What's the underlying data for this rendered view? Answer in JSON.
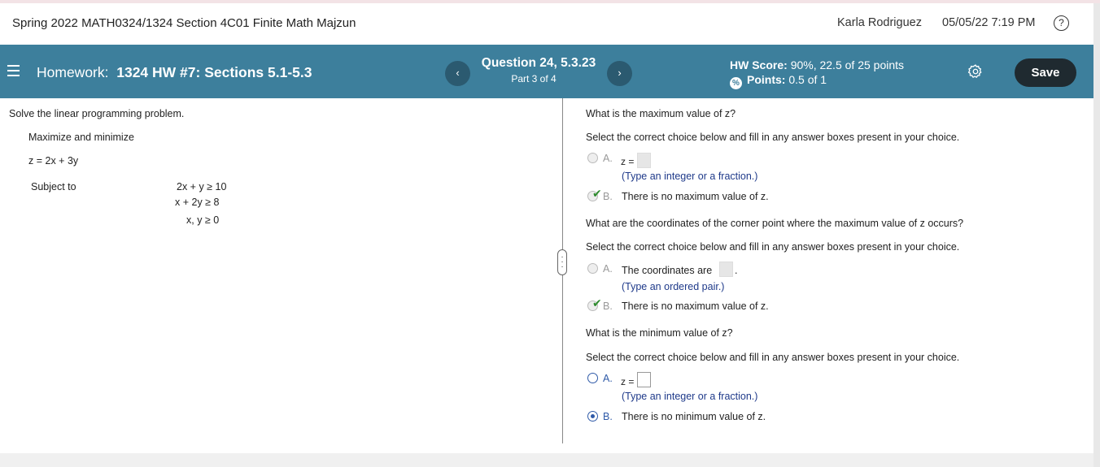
{
  "header": {
    "course_title": "Spring 2022 MATH0324/1324 Section 4C01 Finite Math Majzun",
    "user_name": "Karla Rodriguez",
    "datetime": "05/05/22 7:19 PM",
    "help_glyph": "?"
  },
  "hwbar": {
    "homework_prefix": "Homework:",
    "homework_name": "1324 HW #7: Sections 5.1-5.3",
    "prev_glyph": "‹",
    "next_glyph": "›",
    "question_title": "Question 24, 5.3.23",
    "question_part": "Part 3 of 4",
    "score_label": "HW Score:",
    "score_value": "90%, 22.5 of 25 points",
    "points_label": "Points:",
    "points_value": "0.5 of 1",
    "save_label": "Save",
    "colors": {
      "bar": "#3d7f9c",
      "save_button": "#1f2a30"
    }
  },
  "problem": {
    "instruction": "Solve the linear programming problem.",
    "task": "Maximize and minimize",
    "objective": "z = 2x + 3y",
    "subject_to": "Subject to",
    "constraints": [
      "2x + y  ≥  10",
      "x + 2y  ≥  8",
      "x, y  ≥  0"
    ]
  },
  "questions": [
    {
      "prompt": "What is the maximum value of z?",
      "instruction": "Select the correct choice below and fill in any answer boxes present in your choice.",
      "options": [
        {
          "letter": "A.",
          "text": "z =",
          "hint": "(Type an integer or a fraction.)"
        },
        {
          "letter": "B.",
          "text": "There is no maximum value of z."
        }
      ]
    },
    {
      "prompt": "What are the coordinates of the corner point where the maximum value of z occurs?",
      "instruction": "Select the correct choice below and fill in any answer boxes present in your choice.",
      "options": [
        {
          "letter": "A.",
          "text": "The coordinates are",
          "suffix": ".",
          "hint": "(Type an ordered pair.)"
        },
        {
          "letter": "B.",
          "text": "There is no maximum value of z."
        }
      ]
    },
    {
      "prompt": "What is the minimum value of z?",
      "instruction": "Select the correct choice below and fill in any answer boxes present in your choice.",
      "options": [
        {
          "letter": "A.",
          "text": "z =",
          "hint": "(Type an integer or a fraction.)"
        },
        {
          "letter": "B.",
          "text": "There is no minimum value of z."
        }
      ]
    }
  ],
  "marks": {
    "check_glyph": "✔"
  }
}
